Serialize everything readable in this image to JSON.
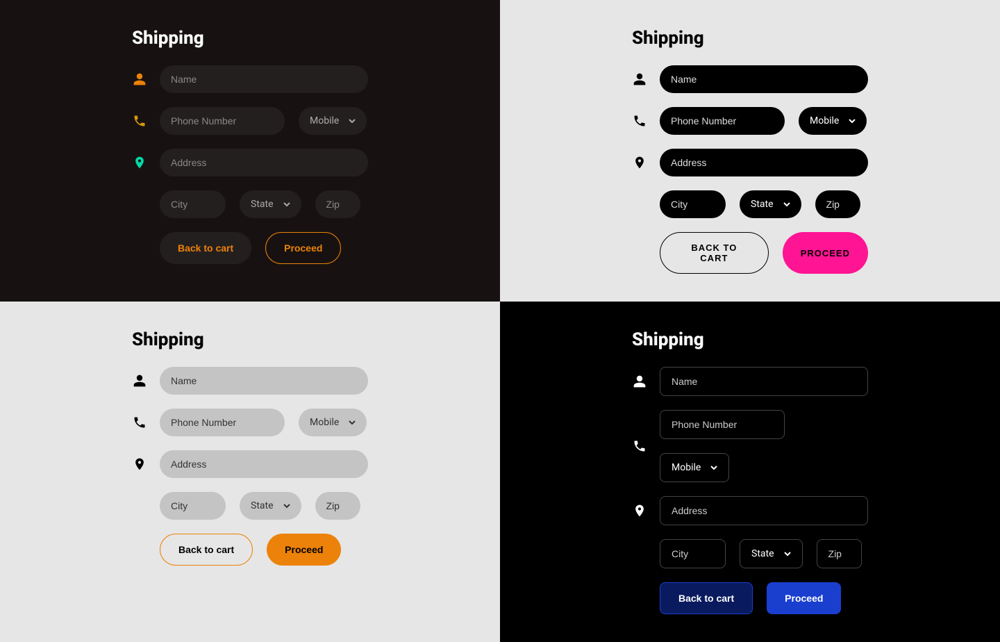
{
  "heading": "Shipping",
  "placeholders": {
    "name": "Name",
    "phone": "Phone Number",
    "address": "Address",
    "city": "City",
    "state": "State",
    "zip": "Zip"
  },
  "phone_type": "Mobile",
  "buttons": {
    "back": "Back to cart",
    "proceed": "Proceed",
    "back_upper": "BACK TO CART",
    "proceed_upper": "PROCEED"
  }
}
